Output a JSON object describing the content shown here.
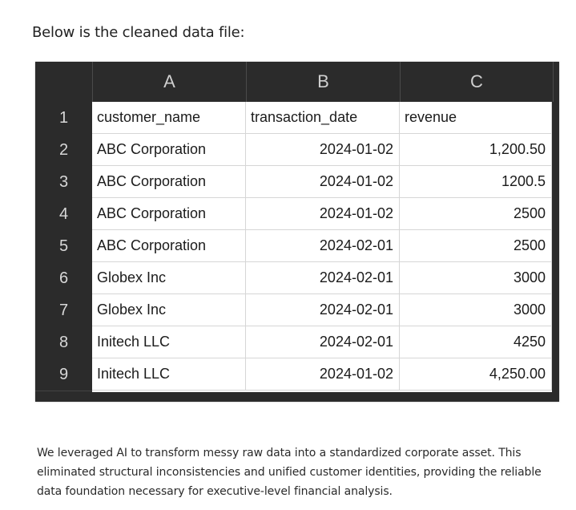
{
  "intro": "Below is the cleaned data file:",
  "sheet": {
    "columns": [
      "A",
      "B",
      "C"
    ],
    "rows": [
      {
        "num": "1",
        "cells": [
          "customer_name",
          "transaction_date",
          "revenue"
        ]
      },
      {
        "num": "2",
        "cells": [
          "ABC Corporation",
          "2024-01-02",
          "1,200.50"
        ]
      },
      {
        "num": "3",
        "cells": [
          "ABC Corporation",
          "2024-01-02",
          "1200.5"
        ]
      },
      {
        "num": "4",
        "cells": [
          "ABC Corporation",
          "2024-01-02",
          "2500"
        ]
      },
      {
        "num": "5",
        "cells": [
          "ABC Corporation",
          "2024-02-01",
          "2500"
        ]
      },
      {
        "num": "6",
        "cells": [
          "Globex Inc",
          "2024-02-01",
          "3000"
        ]
      },
      {
        "num": "7",
        "cells": [
          "Globex Inc",
          "2024-02-01",
          "3000"
        ]
      },
      {
        "num": "8",
        "cells": [
          "Initech LLC",
          "2024-02-01",
          "4250"
        ]
      },
      {
        "num": "9",
        "cells": [
          "Initech LLC",
          "2024-01-02",
          "4,250.00"
        ]
      }
    ]
  },
  "summary": "We leveraged AI to transform messy raw data into a standardized corporate asset. This eliminated structural inconsistencies and unified customer identities, providing the reliable data foundation necessary for executive-level financial analysis."
}
